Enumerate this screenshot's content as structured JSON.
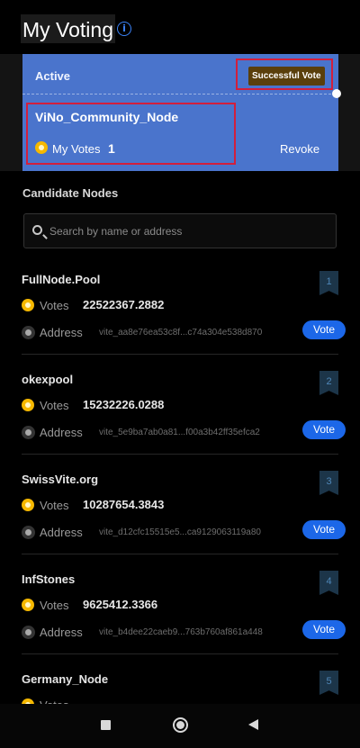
{
  "header": {
    "title": "My Voting",
    "info_icon": "info-circle-icon",
    "accent_color": "#3b82f6"
  },
  "vote_card": {
    "status": "Active",
    "badge": "Successful Vote",
    "node_name": "ViNo_Community_Node",
    "my_votes_label": "My Votes",
    "my_votes_value": "1",
    "revoke_label": "Revoke",
    "card_color": "#4a74cc"
  },
  "candidates": {
    "title": "Candidate Nodes",
    "search_placeholder": "Search by name or address",
    "votes_label": "Votes",
    "address_label": "Address",
    "vote_button": "Vote",
    "nodes": [
      {
        "name": "FullNode.Pool",
        "rank": "1",
        "votes": "22522367.2882",
        "address": "vite_aa8e76ea53c8f...c74a304e538d870"
      },
      {
        "name": "okexpool",
        "rank": "2",
        "votes": "15232226.0288",
        "address": "vite_5e9ba7ab0a81...f00a3b42ff35efca2"
      },
      {
        "name": "SwissVite.org",
        "rank": "3",
        "votes": "10287654.3843",
        "address": "vite_d12cfc15515e5...ca9129063119a80"
      },
      {
        "name": "InfStones",
        "rank": "4",
        "votes": "9625412.3366",
        "address": "vite_b4dee22caeb9...763b760af861a448"
      },
      {
        "name": "Germany_Node",
        "rank": "5",
        "votes": "",
        "address": ""
      }
    ]
  },
  "nav": {
    "recents": "square-icon",
    "home": "circle-home-icon",
    "back": "triangle-back-icon"
  }
}
